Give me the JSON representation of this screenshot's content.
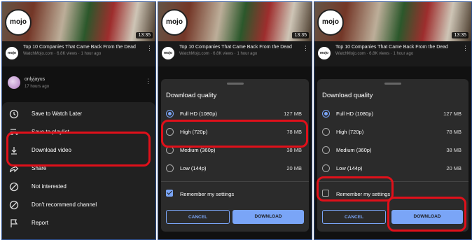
{
  "video": {
    "logo_text": "mojo",
    "duration": "13:35",
    "title": "Top 10 Companies That Came Back From the Dead",
    "meta": "WatchMojo.com · 6.8K views · 1 hour ago",
    "channel_avatar_text": "mojo"
  },
  "comment": {
    "username": "onlyjayus",
    "time": "17 hours ago"
  },
  "menu": {
    "items": [
      {
        "label": "Save to Watch Later",
        "icon": "clock-icon"
      },
      {
        "label": "Save to playlist",
        "icon": "playlist-add-icon"
      },
      {
        "label": "Download video",
        "icon": "download-icon"
      },
      {
        "label": "Share",
        "icon": "share-icon"
      },
      {
        "label": "Not interested",
        "icon": "block-icon"
      },
      {
        "label": "Don't recommend channel",
        "icon": "block-icon"
      },
      {
        "label": "Report",
        "icon": "flag-icon"
      }
    ]
  },
  "dialog": {
    "title": "Download quality",
    "options": [
      {
        "label": "Full HD (1080p)",
        "size": "127 MB"
      },
      {
        "label": "High (720p)",
        "size": "78 MB"
      },
      {
        "label": "Medium (360p)",
        "size": "38 MB"
      },
      {
        "label": "Low (144p)",
        "size": "20 MB"
      }
    ],
    "remember_label": "Remember my settings",
    "cancel_label": "CANCEL",
    "download_label": "DOWNLOAD",
    "panel2_selected": "Full HD (1080p)",
    "panel2_remember_checked": true,
    "panel3_selected": "Full HD (1080p)",
    "panel3_remember_checked": false
  },
  "colors": {
    "accent": "#7aa5f7",
    "highlight": "#e0101a",
    "sheet_bg": "#212121",
    "dialog_bg": "#2b2b2b"
  }
}
